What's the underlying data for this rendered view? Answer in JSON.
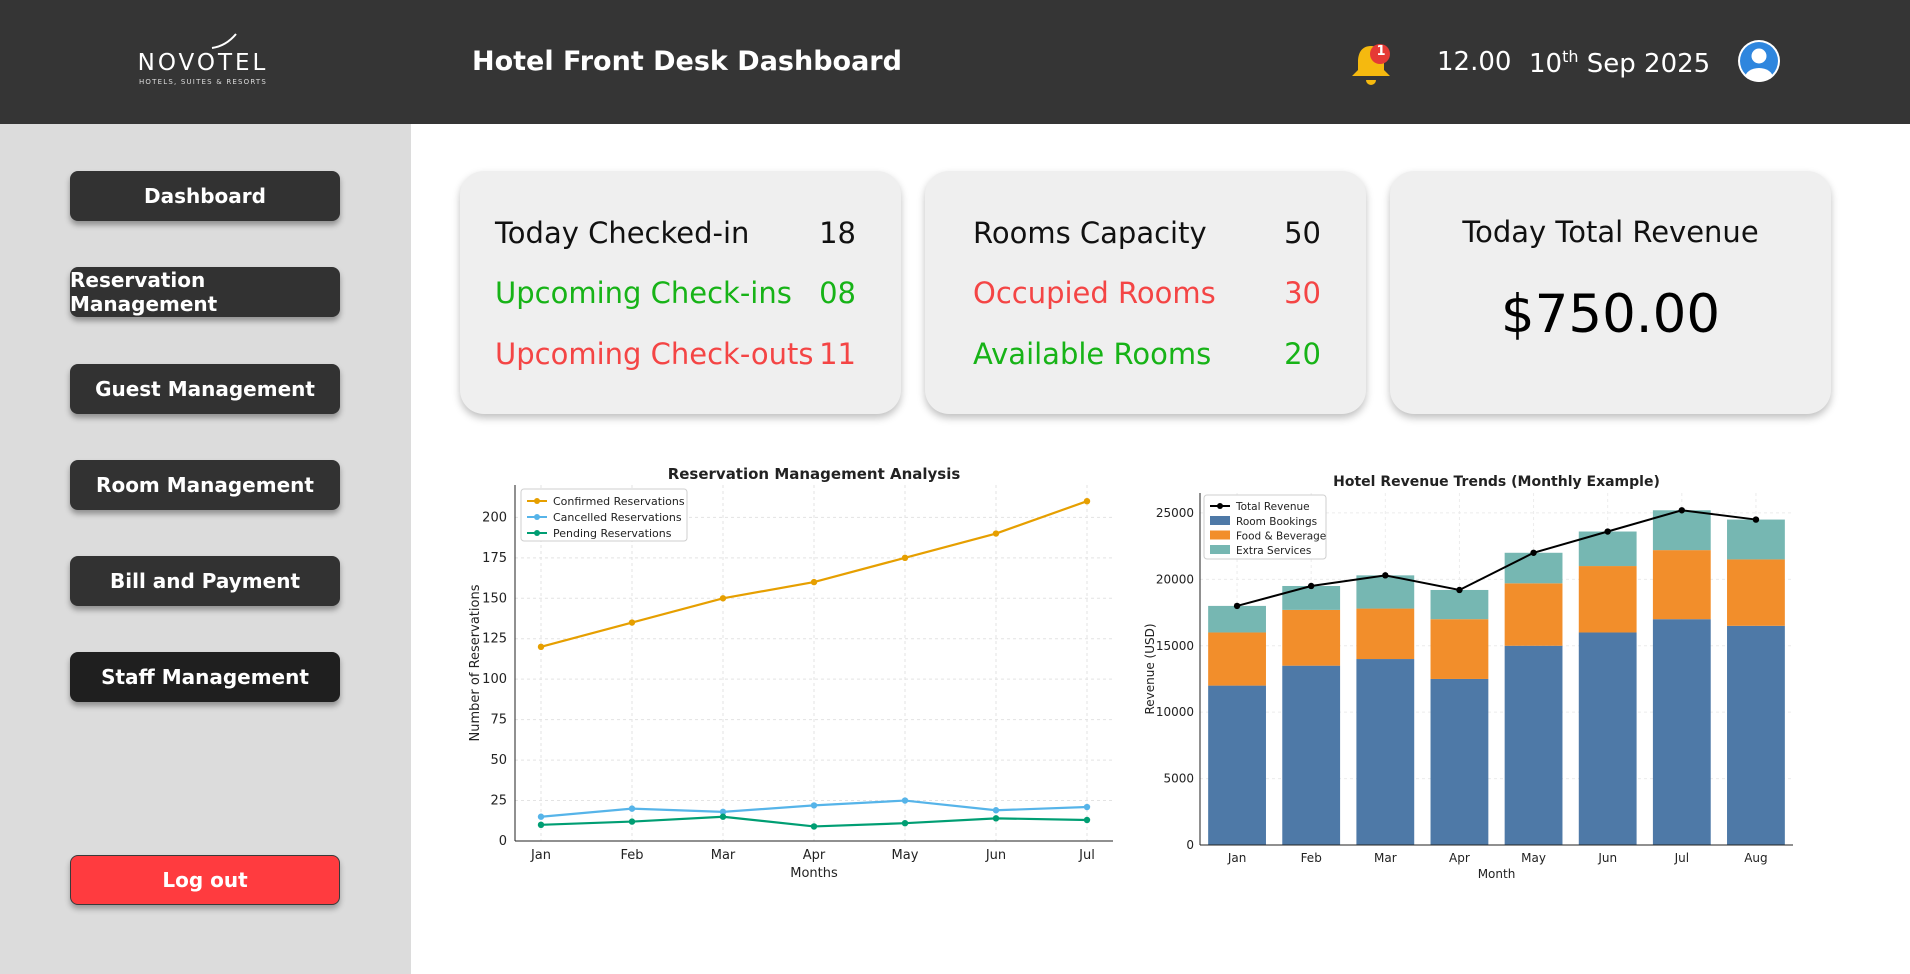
{
  "header": {
    "logo_name": "NOVOTEL",
    "logo_tagline": "HOTELS, SUITES & RESORTS",
    "title": "Hotel Front Desk Dashboard",
    "notification_count": "1",
    "time": "12.00",
    "date_day": "10",
    "date_suffix": "th",
    "date_rest": " Sep 2025"
  },
  "sidebar": {
    "items": [
      {
        "label": "Dashboard"
      },
      {
        "label": "Reservation Management"
      },
      {
        "label": "Guest Management"
      },
      {
        "label": "Room Management"
      },
      {
        "label": "Bill and Payment"
      },
      {
        "label": "Staff Management"
      }
    ],
    "logout_label": "Log out"
  },
  "cards": {
    "checkins": {
      "today_label": "Today Checked-in",
      "today_value": "18",
      "upcoming_in_label": "Upcoming Check-ins",
      "upcoming_in_value": "08",
      "upcoming_out_label": "Upcoming Check-outs",
      "upcoming_out_value": "11"
    },
    "rooms": {
      "capacity_label": "Rooms Capacity",
      "capacity_value": "50",
      "occupied_label": "Occupied Rooms",
      "occupied_value": "30",
      "available_label": "Available Rooms",
      "available_value": "20"
    },
    "revenue": {
      "title": "Today Total Revenue",
      "value": "$750.00"
    }
  },
  "colors": {
    "topbar": "#353535",
    "green": "#17b317",
    "red": "#f44545",
    "logout": "#ff3b3f"
  },
  "chart_data": [
    {
      "type": "line",
      "title": "Reservation Management Analysis",
      "xlabel": "Months",
      "ylabel": "Number of Reservations",
      "categories": [
        "Jan",
        "Feb",
        "Mar",
        "Apr",
        "May",
        "Jun",
        "Jul"
      ],
      "ylim": [
        0,
        220
      ],
      "yticks": [
        0,
        25,
        50,
        75,
        100,
        125,
        150,
        175,
        200
      ],
      "grid": true,
      "legend": "top-left",
      "series": [
        {
          "name": "Confirmed Reservations",
          "color": "#E69F00",
          "values": [
            120,
            135,
            150,
            160,
            175,
            190,
            210
          ]
        },
        {
          "name": "Cancelled Reservations",
          "color": "#56B4E9",
          "values": [
            15,
            20,
            18,
            22,
            25,
            19,
            21
          ]
        },
        {
          "name": "Pending Reservations",
          "color": "#009E73",
          "values": [
            10,
            12,
            15,
            9,
            11,
            14,
            13
          ]
        }
      ]
    },
    {
      "type": "bar",
      "stacked": true,
      "title": "Hotel Revenue Trends (Monthly Example)",
      "xlabel": "Month",
      "ylabel": "Revenue (USD)",
      "categories": [
        "Jan",
        "Feb",
        "Mar",
        "Apr",
        "May",
        "Jun",
        "Jul",
        "Aug"
      ],
      "ylim": [
        0,
        26500
      ],
      "yticks": [
        0,
        5000,
        10000,
        15000,
        20000,
        25000
      ],
      "grid": true,
      "legend": "top-left",
      "series": [
        {
          "name": "Room Bookings",
          "color": "#4e79a7",
          "values": [
            12000,
            13500,
            14000,
            12500,
            15000,
            16000,
            17000,
            16500
          ]
        },
        {
          "name": "Food & Beverage",
          "color": "#f28e2b",
          "values": [
            4000,
            4200,
            3800,
            4500,
            4700,
            5000,
            5200,
            5000
          ]
        },
        {
          "name": "Extra Services",
          "color": "#76b7b2",
          "values": [
            2000,
            1800,
            2500,
            2200,
            2300,
            2600,
            3000,
            3000
          ]
        }
      ],
      "line_series": {
        "name": "Total Revenue",
        "color": "#000000",
        "values": [
          18000,
          19500,
          20300,
          19200,
          22000,
          23600,
          25200,
          24500
        ]
      }
    }
  ]
}
